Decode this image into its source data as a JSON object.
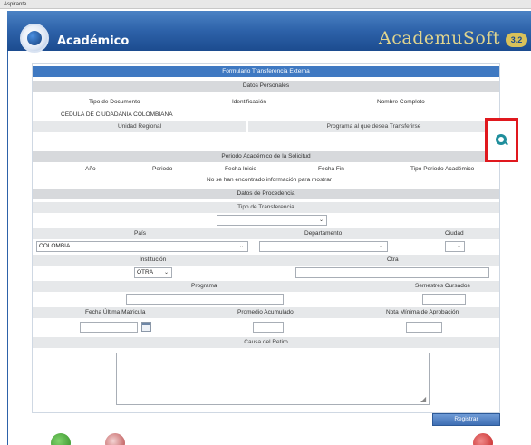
{
  "window": {
    "title": "Aspirante"
  },
  "header": {
    "title": "Académico",
    "brand": "AcademuSoft",
    "version": "3.2"
  },
  "form": {
    "title": "Formulario Transferencia Externa",
    "personal": {
      "section": "Datos Personales",
      "doc_type_label": "Tipo de Documento",
      "id_label": "Identificación",
      "name_label": "Nombre Completo",
      "doc_type_value": "CEDULA DE CIUDADANIA COLOMBIANA",
      "regional_label": "Unidad Regional",
      "program_label": "Programa al que desea Transferirse"
    },
    "period": {
      "section": "Periodo Académico de la Solicitud",
      "columns": [
        "Año",
        "Periodo",
        "Fecha Inicio",
        "Fecha Fin",
        "Tipo Periodo Académico"
      ],
      "empty_message": "No se han encontrado información para mostrar"
    },
    "origin": {
      "section": "Datos de Procedencia",
      "transfer_type_label": "Tipo de Transferencia",
      "transfer_type_value": "",
      "country_label": "País",
      "country_value": "COLOMBIA",
      "department_label": "Departamento",
      "department_value": "",
      "city_label": "Ciudad",
      "city_value": "",
      "institution_label": "Institución",
      "institution_value": "OTRA",
      "other_label": "Otra",
      "program_label": "Programa",
      "semesters_label": "Semestres Cursados",
      "last_enrollment_label": "Fecha Última Matricula",
      "average_label": "Promedio Acumulado",
      "min_grade_label": "Nota Mínima de Aprobación",
      "withdrawal_label": "Causa del Retiro"
    },
    "register_label": "Registrar"
  },
  "colors": {
    "header": "#2d62a9",
    "section_bar": "#3f79c2",
    "highlight": "#e0181e",
    "brand": "#e0d48e"
  }
}
